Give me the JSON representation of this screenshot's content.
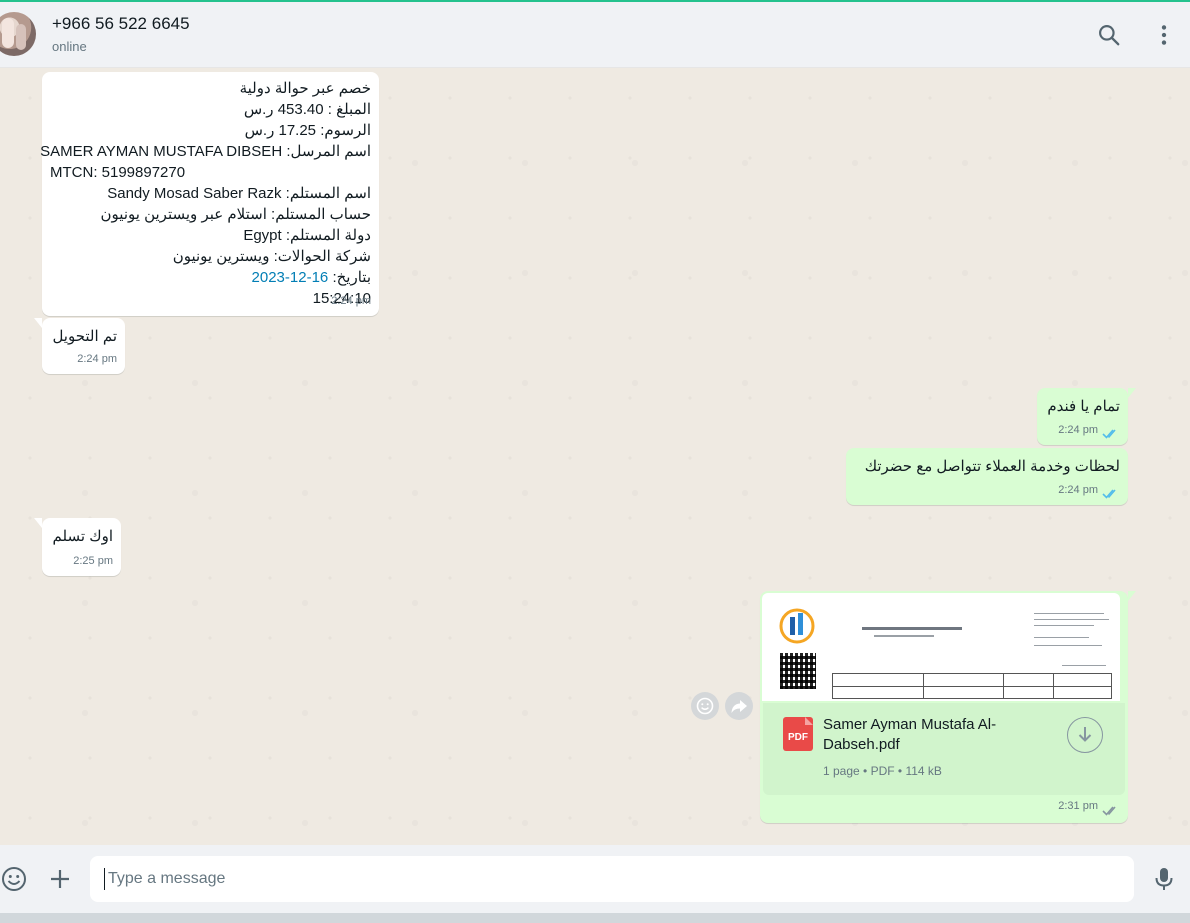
{
  "header": {
    "contact_name": "+966 56 522 6645",
    "status": "online"
  },
  "messages": [
    {
      "direction": "incoming",
      "lines": [
        "خصم عبر حوالة دولية",
        "المبلغ : 453.40 ر.س",
        "الرسوم: 17.25 ر.س",
        "اسم المرسل: SAMER AYMAN MUSTAFA DIBSEH",
        "MTCN: 5199897270",
        "اسم المستلم: Sandy Mosad Saber Razk",
        "حساب المستلم: استلام عبر ويسترين يونيون",
        "دولة المستلم: Egypt",
        "شركة الحوالات: ويسترين يونيون",
        "بتاريخ:"
      ],
      "date_link": "16-12-2023",
      "date_time": "15:24:10",
      "time": "2:24 pm"
    },
    {
      "direction": "incoming",
      "text": "تم التحويل",
      "time": "2:24 pm"
    },
    {
      "direction": "outgoing",
      "text": "تمام يا فندم",
      "time": "2:24 pm"
    },
    {
      "direction": "outgoing",
      "text": "لحظات وخدمة العملاء تتواصل مع حضرتك",
      "time": "2:24 pm"
    },
    {
      "direction": "incoming",
      "text": "اوك تسلم",
      "time": "2:25 pm"
    },
    {
      "direction": "outgoing",
      "type": "document",
      "file_name": "Samer Ayman Mustafa Al-Dabseh.pdf",
      "pages": "1 page",
      "file_type": "PDF",
      "size": "114 kB",
      "badge": "PDF",
      "time": "2:31 pm"
    }
  ],
  "composer": {
    "placeholder": "Type a message"
  },
  "icons": {
    "search": "search-icon",
    "menu": "kebab-menu-icon",
    "emoji": "emoji-icon",
    "attach": "plus-icon",
    "mic": "microphone-icon",
    "download": "download-icon",
    "forward": "forward-icon",
    "react": "emoji-react-icon",
    "read": "double-check-icon"
  },
  "colors": {
    "incoming_bubble": "#ffffff",
    "outgoing_bubble": "#d9fdd3",
    "read_ticks": "#53bdeb",
    "link": "#027eb5",
    "accent_line": "#25c28e"
  }
}
